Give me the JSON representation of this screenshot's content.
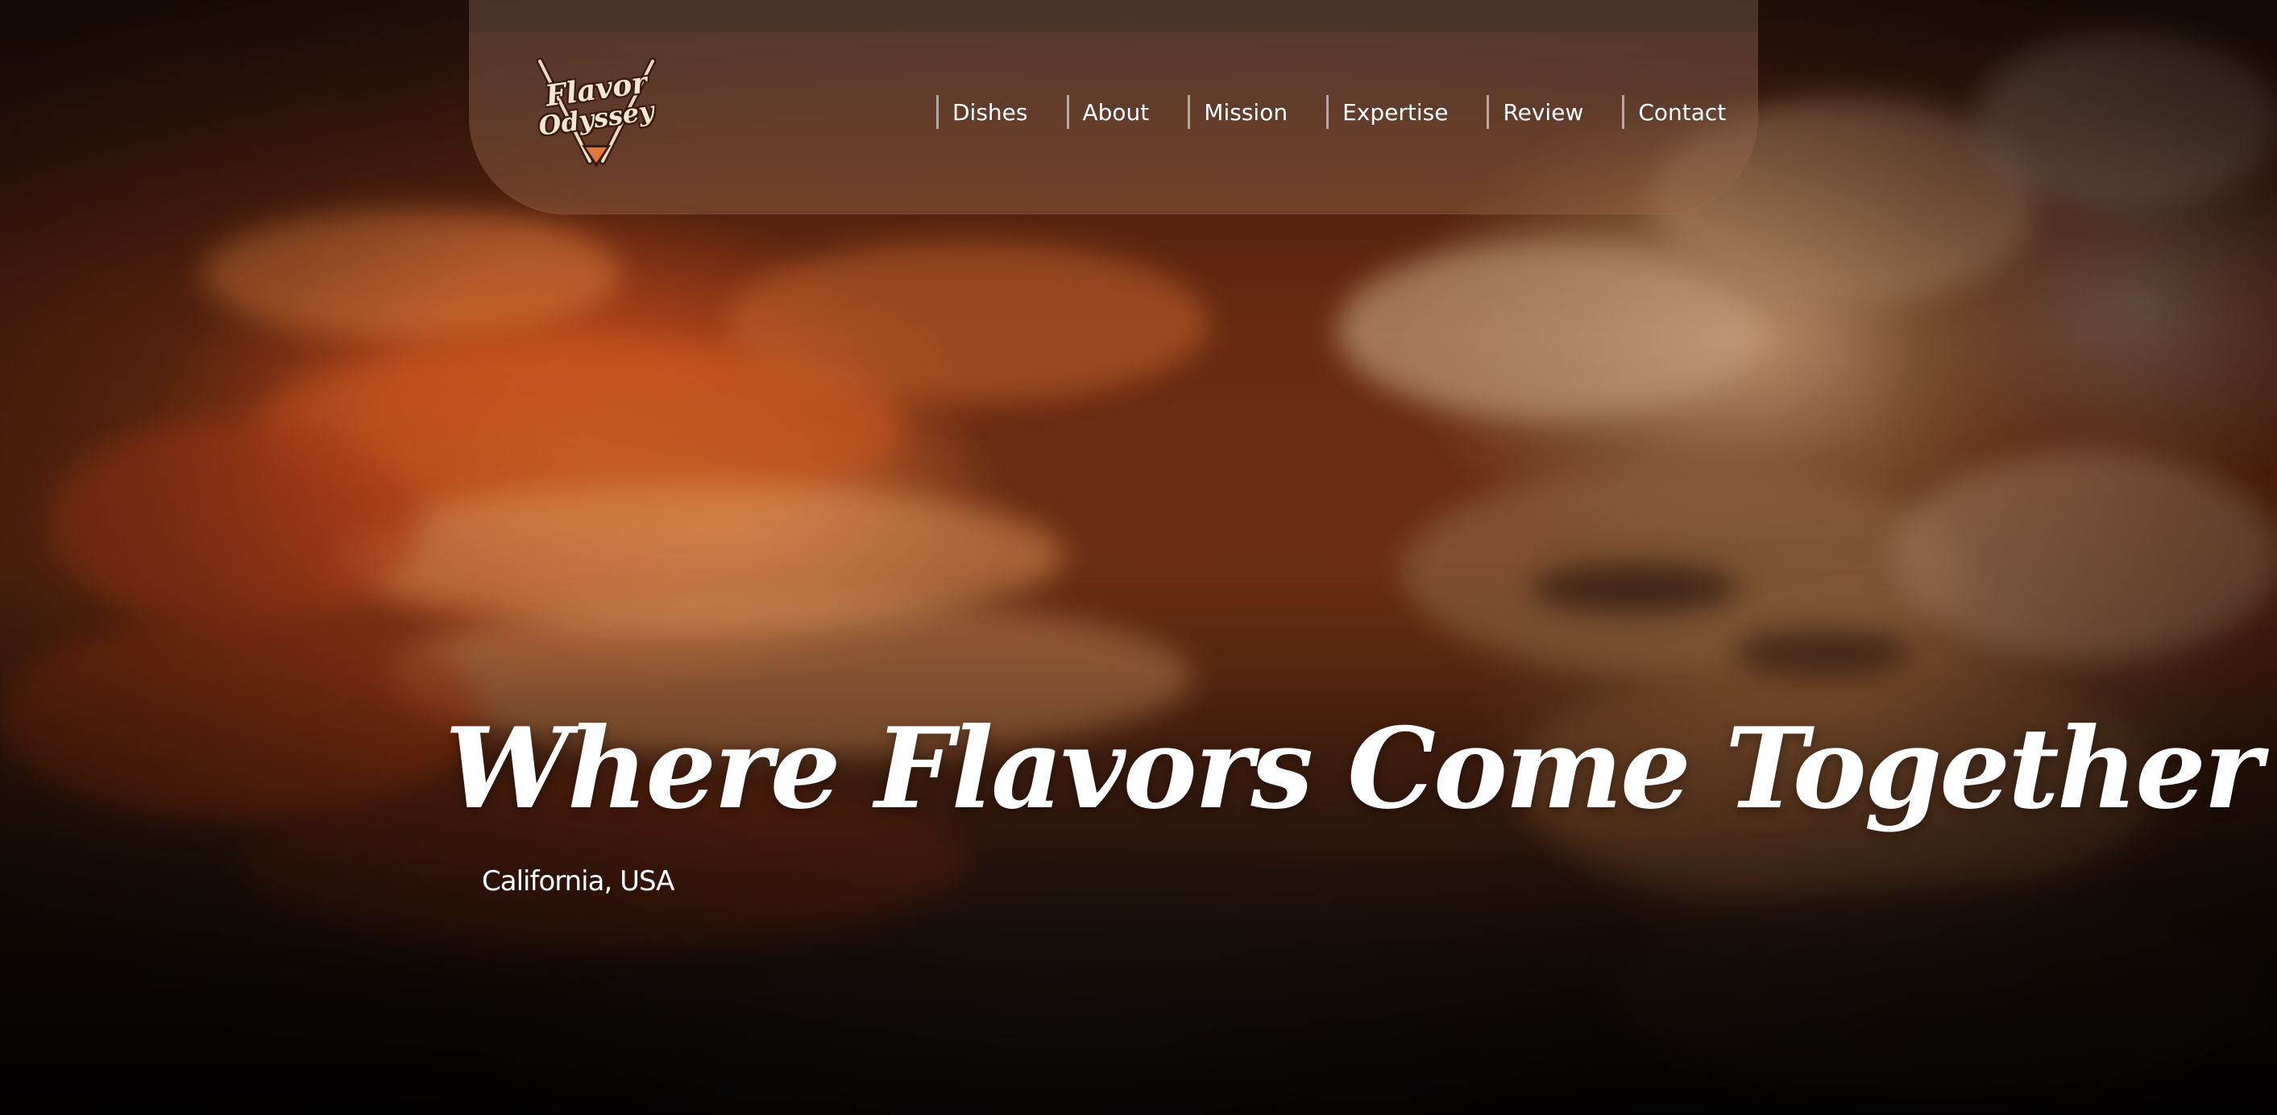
{
  "brand": {
    "logo_line1": "Flavor",
    "logo_line2": "Odyssey"
  },
  "nav": {
    "items": [
      {
        "label": "Dishes"
      },
      {
        "label": "About"
      },
      {
        "label": "Mission"
      },
      {
        "label": "Expertise"
      },
      {
        "label": "Review"
      },
      {
        "label": "Contact"
      }
    ]
  },
  "hero": {
    "headline": "Where Flavors Come Together",
    "location": "California, USA"
  },
  "colors": {
    "text": "#ffffff",
    "logo_cream": "#f6e7d0",
    "logo_outline": "#3a1b10",
    "accent_orange": "#d9692a"
  }
}
